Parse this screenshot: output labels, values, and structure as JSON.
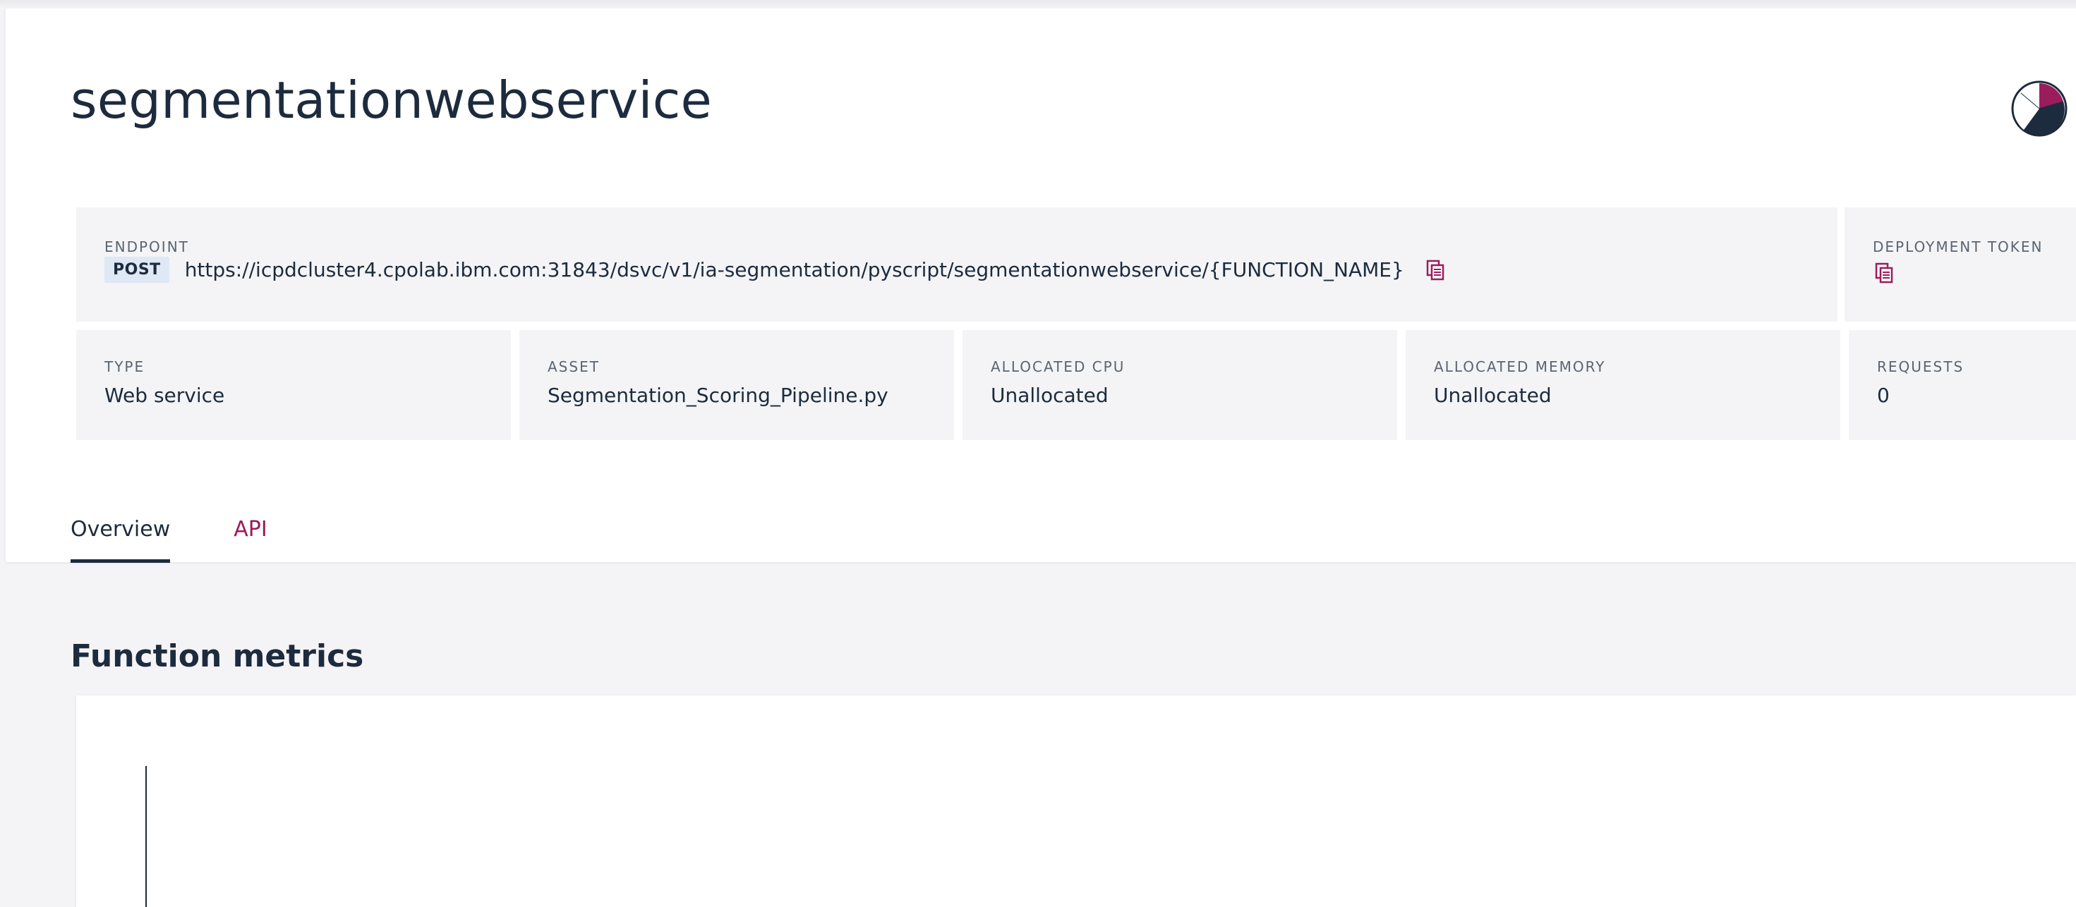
{
  "page": {
    "title": "segmentationwebservice"
  },
  "endpoint": {
    "label": "ENDPOINT",
    "method": "POST",
    "url": "https://icpdcluster4.cpolab.ibm.com:31843/dsvc/v1/ia-segmentation/pyscript/segmentationwebservice/{FUNCTION_NAME}",
    "copy_icon": "copy-icon"
  },
  "token": {
    "label": "DEPLOYMENT TOKEN",
    "copy_icon": "copy-icon"
  },
  "details": [
    {
      "label": "TYPE",
      "value": "Web service"
    },
    {
      "label": "ASSET",
      "value": "Segmentation_Scoring_Pipeline.py"
    },
    {
      "label": "ALLOCATED CPU",
      "value": "Unallocated"
    },
    {
      "label": "ALLOCATED MEMORY",
      "value": "Unallocated"
    },
    {
      "label": "REQUESTS",
      "value": "0"
    }
  ],
  "tabs": [
    {
      "label": "Overview",
      "active": true
    },
    {
      "label": "API",
      "active": false
    }
  ],
  "metrics": {
    "title": "Function metrics"
  },
  "colors": {
    "accent": "#9b1c5c",
    "text": "#1c2b3d",
    "card_bg": "#f4f4f6",
    "badge_bg": "#dfe8f5"
  },
  "avatar_icon": "user-avatar-icon"
}
